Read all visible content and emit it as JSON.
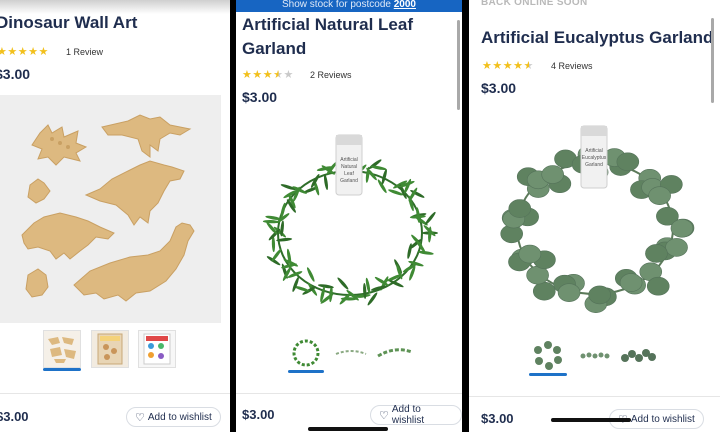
{
  "panels": [
    {
      "title": "Dinosaur Wall Art",
      "rating": 5,
      "reviews": "1 Review",
      "price": "$3.00",
      "thumb_count": 3,
      "bottom_price": "$3.00",
      "wishlist": "Add to wishlist"
    },
    {
      "banner_text": "Show stock for postcode ",
      "banner_postcode": "2000",
      "title_line1": "Artificial Natural Leaf",
      "title_line2": "Garland",
      "rating": 3.5,
      "reviews": "2 Reviews",
      "price": "$3.00",
      "package_label": "Artificial Natural Leaf Garland",
      "thumb_count": 3,
      "bottom_price": "$3.00",
      "wishlist": "Add to wishlist"
    },
    {
      "notice": "BACK ONLINE SOON",
      "title": "Artificial Eucalyptus Garland",
      "rating": 4.5,
      "reviews": "4 Reviews",
      "price": "$3.00",
      "package_label": "Artificial Eucalyptus Garland",
      "thumb_count": 3,
      "bottom_price": "$3.00",
      "wishlist": "Add to wishlist"
    }
  ],
  "colors": {
    "accent": "#1e72c8",
    "banner": "#1765c2",
    "star": "#f2c01c",
    "text": "#1f2d4e"
  },
  "icons": [
    "star-icon",
    "heart-icon"
  ]
}
